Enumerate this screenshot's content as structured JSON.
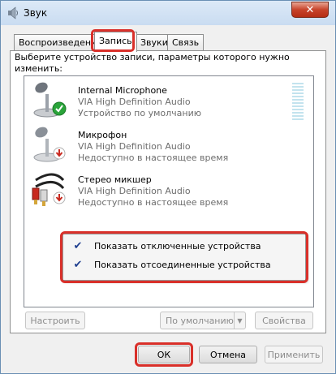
{
  "window": {
    "title": "Звук",
    "close_glyph": "✕"
  },
  "tabs": [
    {
      "label": "Воспроизведение",
      "active": false
    },
    {
      "label": "Запись",
      "active": true
    },
    {
      "label": "Звуки",
      "active": false
    },
    {
      "label": "Связь",
      "active": false
    }
  ],
  "instruction": "Выберите устройство записи, параметры которого нужно изменить:",
  "devices": [
    {
      "name": "Internal Microphone",
      "driver": "VIA High Definition Audio",
      "status": "Устройство по умолчанию",
      "icon": "microphone-icon",
      "badge": "default-check-icon"
    },
    {
      "name": "Микрофон",
      "driver": "VIA High Definition Audio",
      "status": "Недоступно в настоящее время",
      "icon": "microphone-icon",
      "badge": "unavailable-arrow-icon"
    },
    {
      "name": "Стерео микшер",
      "driver": "VIA High Definition Audio",
      "status": "Недоступно в настоящее время",
      "icon": "audio-cable-icon",
      "badge": "unavailable-arrow-icon"
    }
  ],
  "context_menu": {
    "items": [
      {
        "label": "Показать отключенные устройства",
        "checked": true
      },
      {
        "label": "Показать отсоединенные устройства",
        "checked": true
      }
    ],
    "check_glyph": "✔"
  },
  "buttons": {
    "configure": "Настроить",
    "set_default": "По умолчанию",
    "properties": "Свойства",
    "ok": "ОК",
    "cancel": "Отмена",
    "apply": "Применить"
  },
  "colors": {
    "highlight": "#d9302a",
    "default_badge": "#2aa43a",
    "unavailable_badge": "#c8281e"
  }
}
